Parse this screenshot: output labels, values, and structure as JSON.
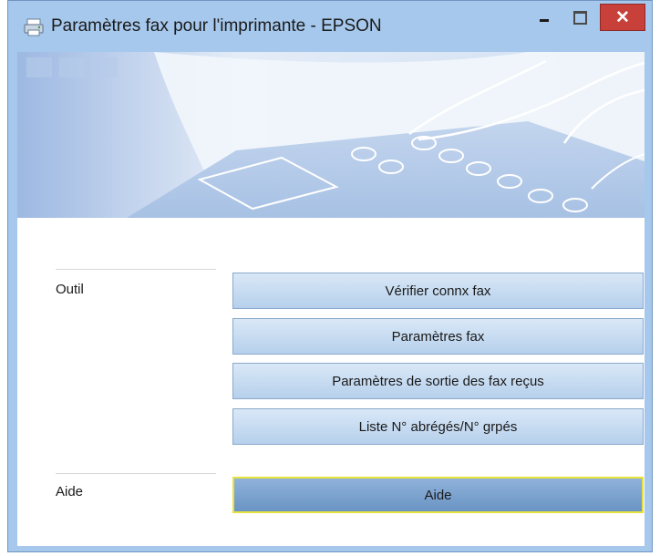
{
  "window": {
    "title": "Paramètres fax pour l'imprimante - EPSON",
    "close_glyph": "✕",
    "icons": [
      "printer-fax-icon",
      "minimize-icon",
      "maximize-icon",
      "close-icon"
    ]
  },
  "sections": {
    "outil_label": "Outil",
    "aide_label": "Aide"
  },
  "buttons": {
    "check_connection": "Vérifier connx fax",
    "fax_settings": "Paramètres fax",
    "received_output": "Paramètres de sortie des fax reçus",
    "speed_dial_list": "Liste N° abrégés/N° grpés",
    "help": "Aide"
  },
  "colors": {
    "frame": "#a6c8ec",
    "close": "#c7403a",
    "button": "#c9ddf2",
    "focus_border": "#e8e23a"
  }
}
